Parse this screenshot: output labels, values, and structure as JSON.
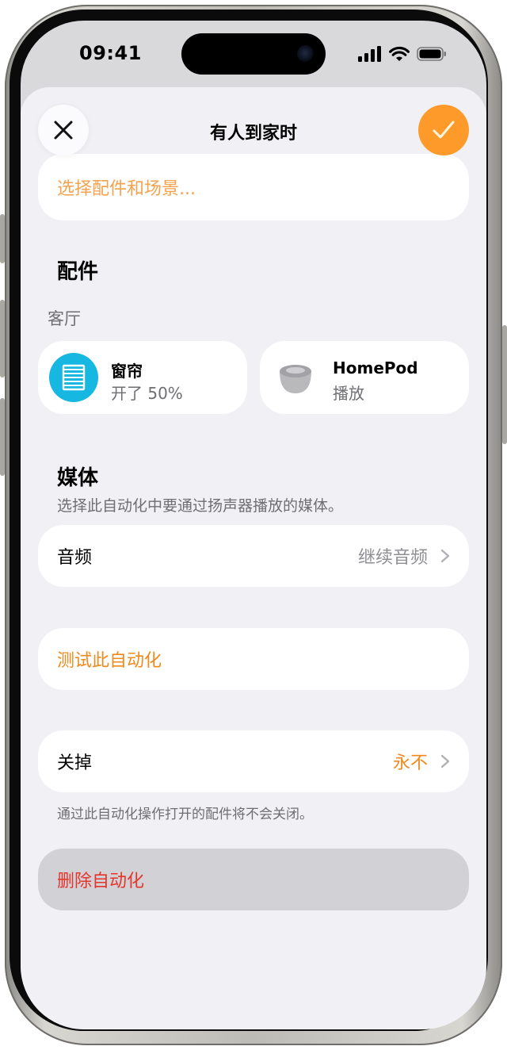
{
  "status_bar": {
    "time": "09:41"
  },
  "nav": {
    "title": "有人到家时"
  },
  "select_accessories_scenes": "选择配件和场景...",
  "accessories": {
    "heading": "配件",
    "room": "客厅",
    "tiles": [
      {
        "name": "窗帘",
        "state": "开了 50%",
        "icon": "blinds-icon"
      },
      {
        "name": "HomePod",
        "state": "播放",
        "icon": "homepod-mini-icon"
      }
    ]
  },
  "media": {
    "heading": "媒体",
    "description": "选择此自动化中要通过扬声器播放的媒体。",
    "audio_label": "音频",
    "audio_value": "继续音频"
  },
  "test_automation": "测试此自动化",
  "turn_off": {
    "label": "关掉",
    "value": "永不",
    "footnote": "通过此自动化操作打开的配件将不会关闭。"
  },
  "delete_automation": "删除自动化",
  "colors": {
    "accent_orange": "#f08a1c",
    "done_button": "#fd9a2a",
    "destructive_red": "#e5342b",
    "blinds_icon_bg": "#16b7e0"
  }
}
